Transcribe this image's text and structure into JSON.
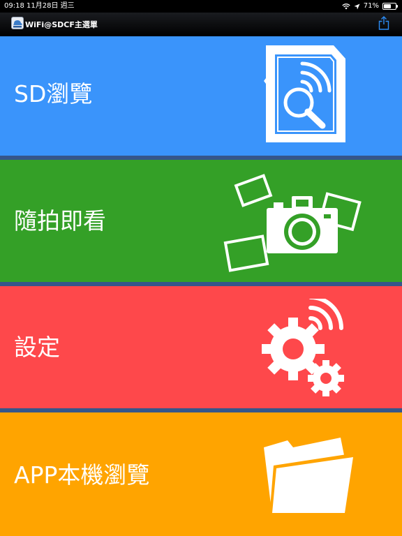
{
  "status_bar": {
    "time": "09:18",
    "date": "11月28日 週三",
    "battery": "71%",
    "battery_level": 0.71
  },
  "title_bar": {
    "title": "WiFi@SDCF主選單"
  },
  "menu": [
    {
      "label": "SD瀏覽",
      "color": "#3a94fb",
      "icon": "sd-card-search-icon"
    },
    {
      "label": "隨拍即看",
      "color": "#34a027",
      "icon": "camera-photos-icon"
    },
    {
      "label": "設定",
      "color": "#fe484b",
      "icon": "wireless-gears-icon"
    },
    {
      "label": "APP本機瀏覽",
      "color": "#ffa400",
      "icon": "folder-icon"
    }
  ],
  "colors": {
    "divider": "#35568a",
    "title_bar": "#000000"
  }
}
